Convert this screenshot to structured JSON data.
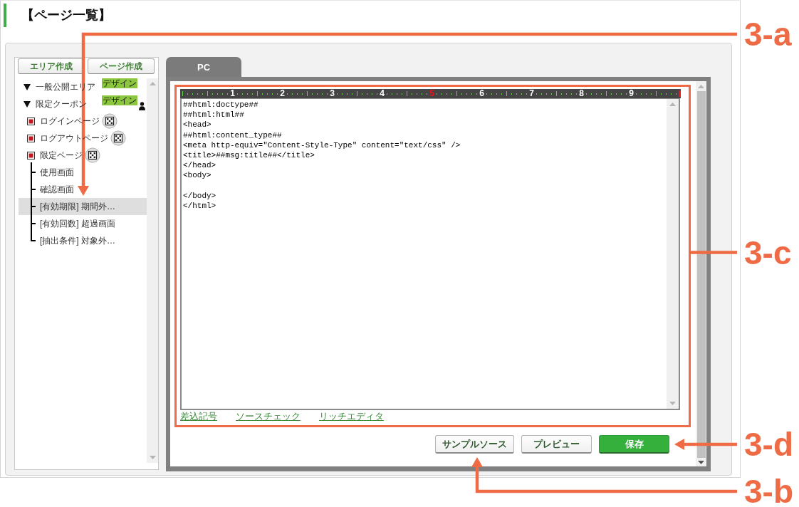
{
  "page": {
    "title": "【ページ一覧】"
  },
  "sidebar": {
    "buttons": [
      "エリア作成",
      "ページ作成"
    ],
    "tree": [
      {
        "label": "一般公開エリア",
        "kind": "area",
        "expanded": true,
        "selected": false,
        "badge": "デザイン",
        "person_mark": false
      },
      {
        "label": "限定クーポン",
        "kind": "area",
        "expanded": true,
        "selected": false,
        "badge": "デザイン",
        "person_mark": true,
        "children": [
          {
            "label": "ログインページ",
            "kind": "page",
            "selected": false
          },
          {
            "label": "ログアウトページ",
            "kind": "page",
            "selected": false
          },
          {
            "label": "限定ページ",
            "kind": "page",
            "selected": false,
            "children": [
              {
                "label": "使用画面",
                "kind": "screen",
                "selected": false
              },
              {
                "label": "確認画面",
                "kind": "screen",
                "selected": false
              },
              {
                "label": "[有効期限] 期間外…",
                "kind": "screen",
                "selected": true
              },
              {
                "label": "[有効回数] 超過画面",
                "kind": "screen",
                "selected": false
              },
              {
                "label": "[抽出条件] 対象外…",
                "kind": "screen",
                "selected": false
              }
            ]
          }
        ]
      }
    ]
  },
  "editor": {
    "tabs": [
      {
        "label": "PC",
        "selected": true
      }
    ],
    "ruler": {
      "marks": [
        {
          "label": "1",
          "highlighted": false
        },
        {
          "label": "2",
          "highlighted": false
        },
        {
          "label": "3",
          "highlighted": false
        },
        {
          "label": "4",
          "highlighted": false
        },
        {
          "label": "5",
          "highlighted": true
        },
        {
          "label": "6",
          "highlighted": false
        },
        {
          "label": "7",
          "highlighted": false
        },
        {
          "label": "8",
          "highlighted": false
        },
        {
          "label": "9",
          "highlighted": false
        }
      ]
    },
    "code": "##html:doctype##\n##html:html##\n<head>\n##html:content_type##\n<meta http-equiv=\"Content-Style-Type\" content=\"text/css\" />\n<title>##msg:title##</title>\n</head>\n<body>\n\n</body>\n</html>",
    "links": [
      "差込記号",
      "ソースチェック",
      "リッチエディタ"
    ],
    "buttons": [
      {
        "label": "サンプルソース",
        "kind": "default"
      },
      {
        "label": "プレビュー",
        "kind": "default"
      },
      {
        "label": "保存",
        "kind": "primary"
      }
    ]
  },
  "callouts": [
    {
      "label": "3-a",
      "kind": "elbow_down"
    },
    {
      "label": "3-c",
      "kind": "frame"
    },
    {
      "label": "3-d",
      "kind": "arrow"
    },
    {
      "label": "3-b",
      "kind": "elbow_up"
    }
  ]
}
